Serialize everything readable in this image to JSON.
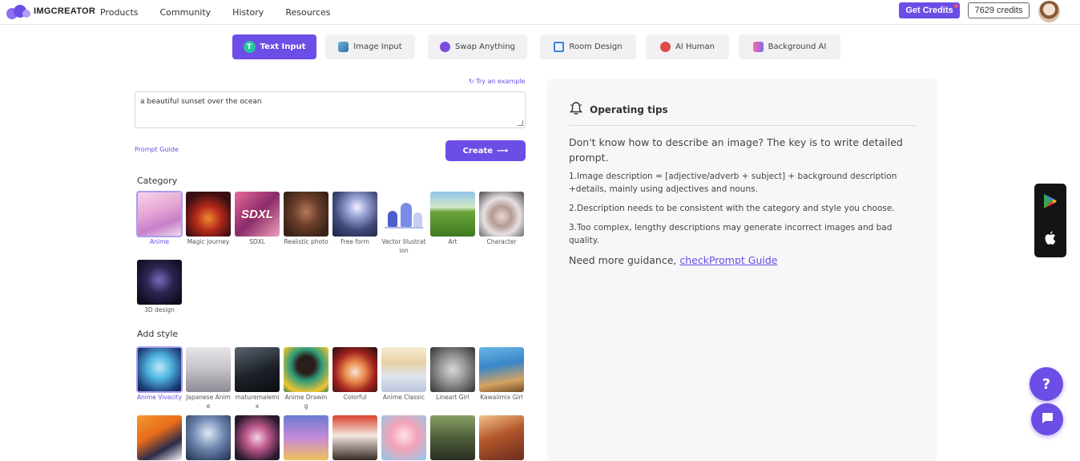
{
  "header": {
    "logo_text": "IMGCREATOR",
    "nav": [
      "Products",
      "Community",
      "History",
      "Resources"
    ],
    "get_credits_label": "Get Credits",
    "credits_label": "7629 credits"
  },
  "tabs": [
    {
      "label": "Text Input",
      "icon": "text-input-icon",
      "color": "#6c4de6"
    },
    {
      "label": "Image Input",
      "icon": "image-icon",
      "color": "#4a7fb0"
    },
    {
      "label": "Swap Anything",
      "icon": "swap-icon",
      "color": "#7b4ce0"
    },
    {
      "label": "Room Design",
      "icon": "house-icon",
      "color": "#3b82d6"
    },
    {
      "label": "AI Human",
      "icon": "ai-human-icon",
      "color": "#e04a4a"
    },
    {
      "label": "Background AI",
      "icon": "background-ai-icon",
      "color": "#7b6bf0"
    }
  ],
  "prompt": {
    "try_example": "Try an example",
    "value": "a beautiful sunset over the ocean",
    "guide_label": "Prompt Guide",
    "create_label": "Create"
  },
  "category": {
    "title": "Category",
    "items": [
      {
        "label": "Anime",
        "selected": true
      },
      {
        "label": "Magic journey",
        "selected": false
      },
      {
        "label": "SDXL",
        "selected": false
      },
      {
        "label": "Realistic photo",
        "selected": false
      },
      {
        "label": "Free form",
        "selected": false
      },
      {
        "label": "Vector Illustration",
        "selected": false
      },
      {
        "label": "Art",
        "selected": false
      },
      {
        "label": "Character",
        "selected": false
      },
      {
        "label": "3D design",
        "selected": false
      }
    ]
  },
  "style": {
    "title": "Add style",
    "items": [
      {
        "label": "Anime Vivacity",
        "selected": true
      },
      {
        "label": "Japanese Anime",
        "selected": false
      },
      {
        "label": "maturemalemix",
        "selected": false
      },
      {
        "label": "Anime Drawing",
        "selected": false
      },
      {
        "label": "Colorful",
        "selected": false
      },
      {
        "label": "Anime Classic",
        "selected": false
      },
      {
        "label": "Lineart Girl",
        "selected": false
      },
      {
        "label": "Kawaiimix Girl",
        "selected": false
      }
    ]
  },
  "tips": {
    "title": "Operating tips",
    "intro": "Don't know how to describe an image? The key is to write detailed prompt.",
    "items": [
      "1.Image description = [adjective/adverb + subject] + background description +details, mainly using adjectives and nouns.",
      "2.Description needs to be consistent with the category and style you choose.",
      "3.Too complex, lengthy descriptions may generate incorrect images and bad quality."
    ],
    "more_prefix": "Need more guidance, ",
    "more_link": "checkPrompt Guide"
  },
  "fab": {
    "help_label": "?"
  },
  "colors": {
    "accent": "#6c4de6",
    "panel": "#f7f7f9"
  }
}
